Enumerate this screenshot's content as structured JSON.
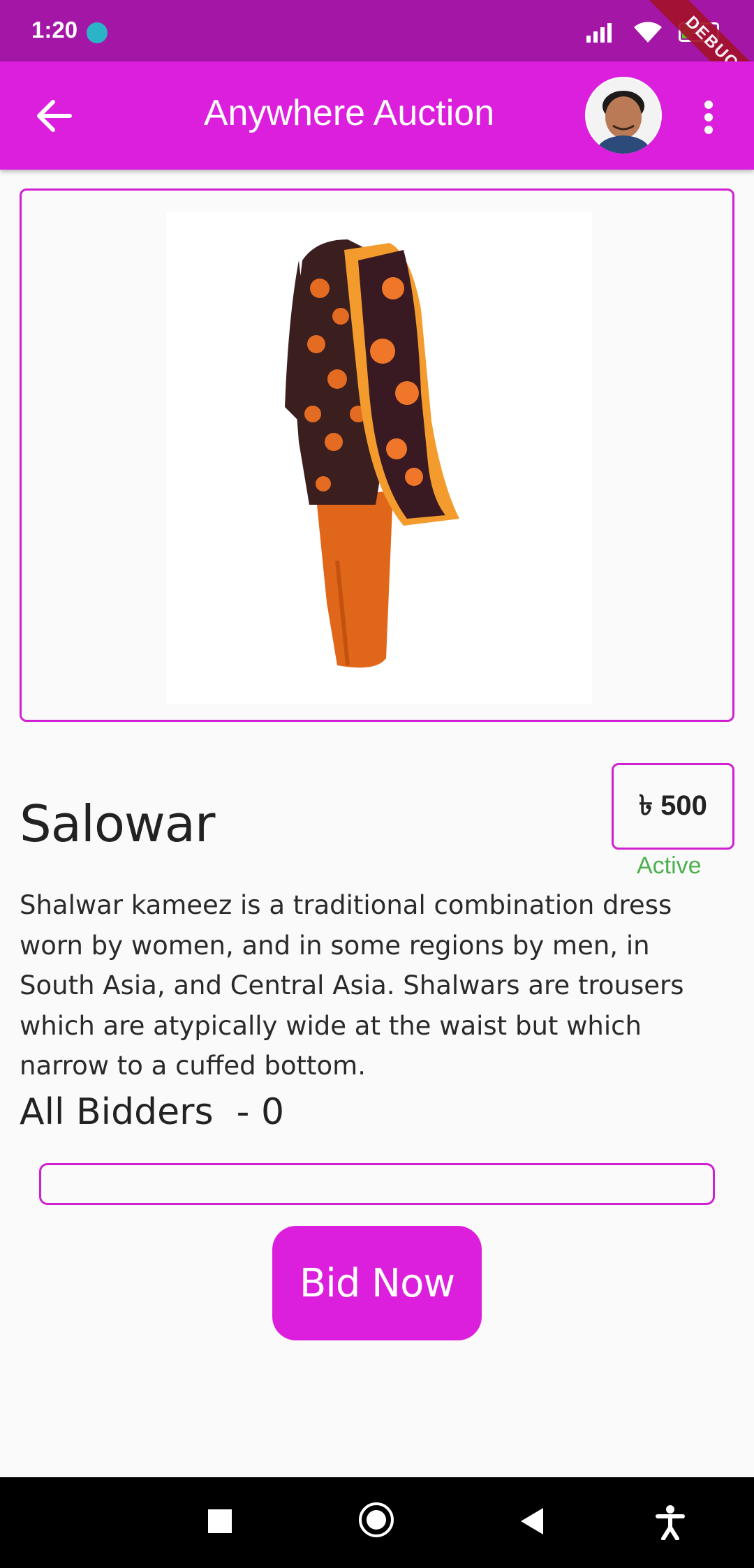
{
  "status_bar": {
    "time": "1:20",
    "battery": "29",
    "debug_label": "DEBUG",
    "icons": [
      "android-icon",
      "signal-icon",
      "wifi-icon",
      "battery-icon"
    ]
  },
  "app_bar": {
    "title": "Anywhere Auction",
    "back_icon": "arrow-back-icon",
    "menu_icon": "more-vert-icon"
  },
  "product": {
    "name": "Salowar",
    "price": "৳ 500",
    "status": "Active",
    "description": "Shalwar kameez is a traditional combination dress worn by women, and in some regions by men, in South Asia, and Central Asia. Shalwars are trousers which are atypically wide at the waist but which narrow to a cuffed bottom."
  },
  "bidders": {
    "label": "All Bidders  - 0"
  },
  "bid_input": {
    "value": ""
  },
  "bid_button": {
    "label": "Bid Now"
  },
  "colors": {
    "app_bar": "#dc1fdd",
    "status_bar": "#a316a6",
    "accent_border": "#d11fd2",
    "active_status": "#4caf50"
  },
  "nav_bar": {
    "icons": [
      "recents-square-icon",
      "home-circle-icon",
      "back-triangle-icon",
      "accessibility-icon"
    ]
  }
}
